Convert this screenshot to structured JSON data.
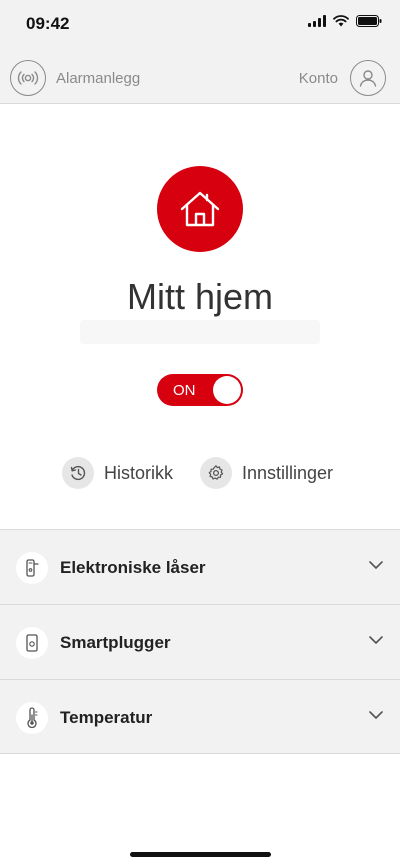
{
  "status_bar": {
    "time": "09:42",
    "icons": [
      "signal-icon",
      "wifi-icon",
      "battery-icon"
    ]
  },
  "nav": {
    "left_icon": "alarm-icon",
    "left_label": "Alarmanlegg",
    "right_label": "Konto",
    "right_icon": "user-icon"
  },
  "home": {
    "icon": "house-icon",
    "title": "Mitt hjem",
    "toggle_label": "ON",
    "toggle_on": true
  },
  "actions": [
    {
      "label": "Historikk",
      "icon": "history-icon"
    },
    {
      "label": "Innstillinger",
      "icon": "gear-icon"
    }
  ],
  "sections": [
    {
      "label": "Elektroniske låser",
      "icon": "door-lock-icon"
    },
    {
      "label": "Smartplugger",
      "icon": "smart-plug-icon"
    },
    {
      "label": "Temperatur",
      "icon": "thermometer-icon"
    }
  ],
  "colors": {
    "accent": "#d7000f",
    "header_bg": "#f2f2f2",
    "text": "#333333",
    "muted": "#8a8a8a"
  }
}
